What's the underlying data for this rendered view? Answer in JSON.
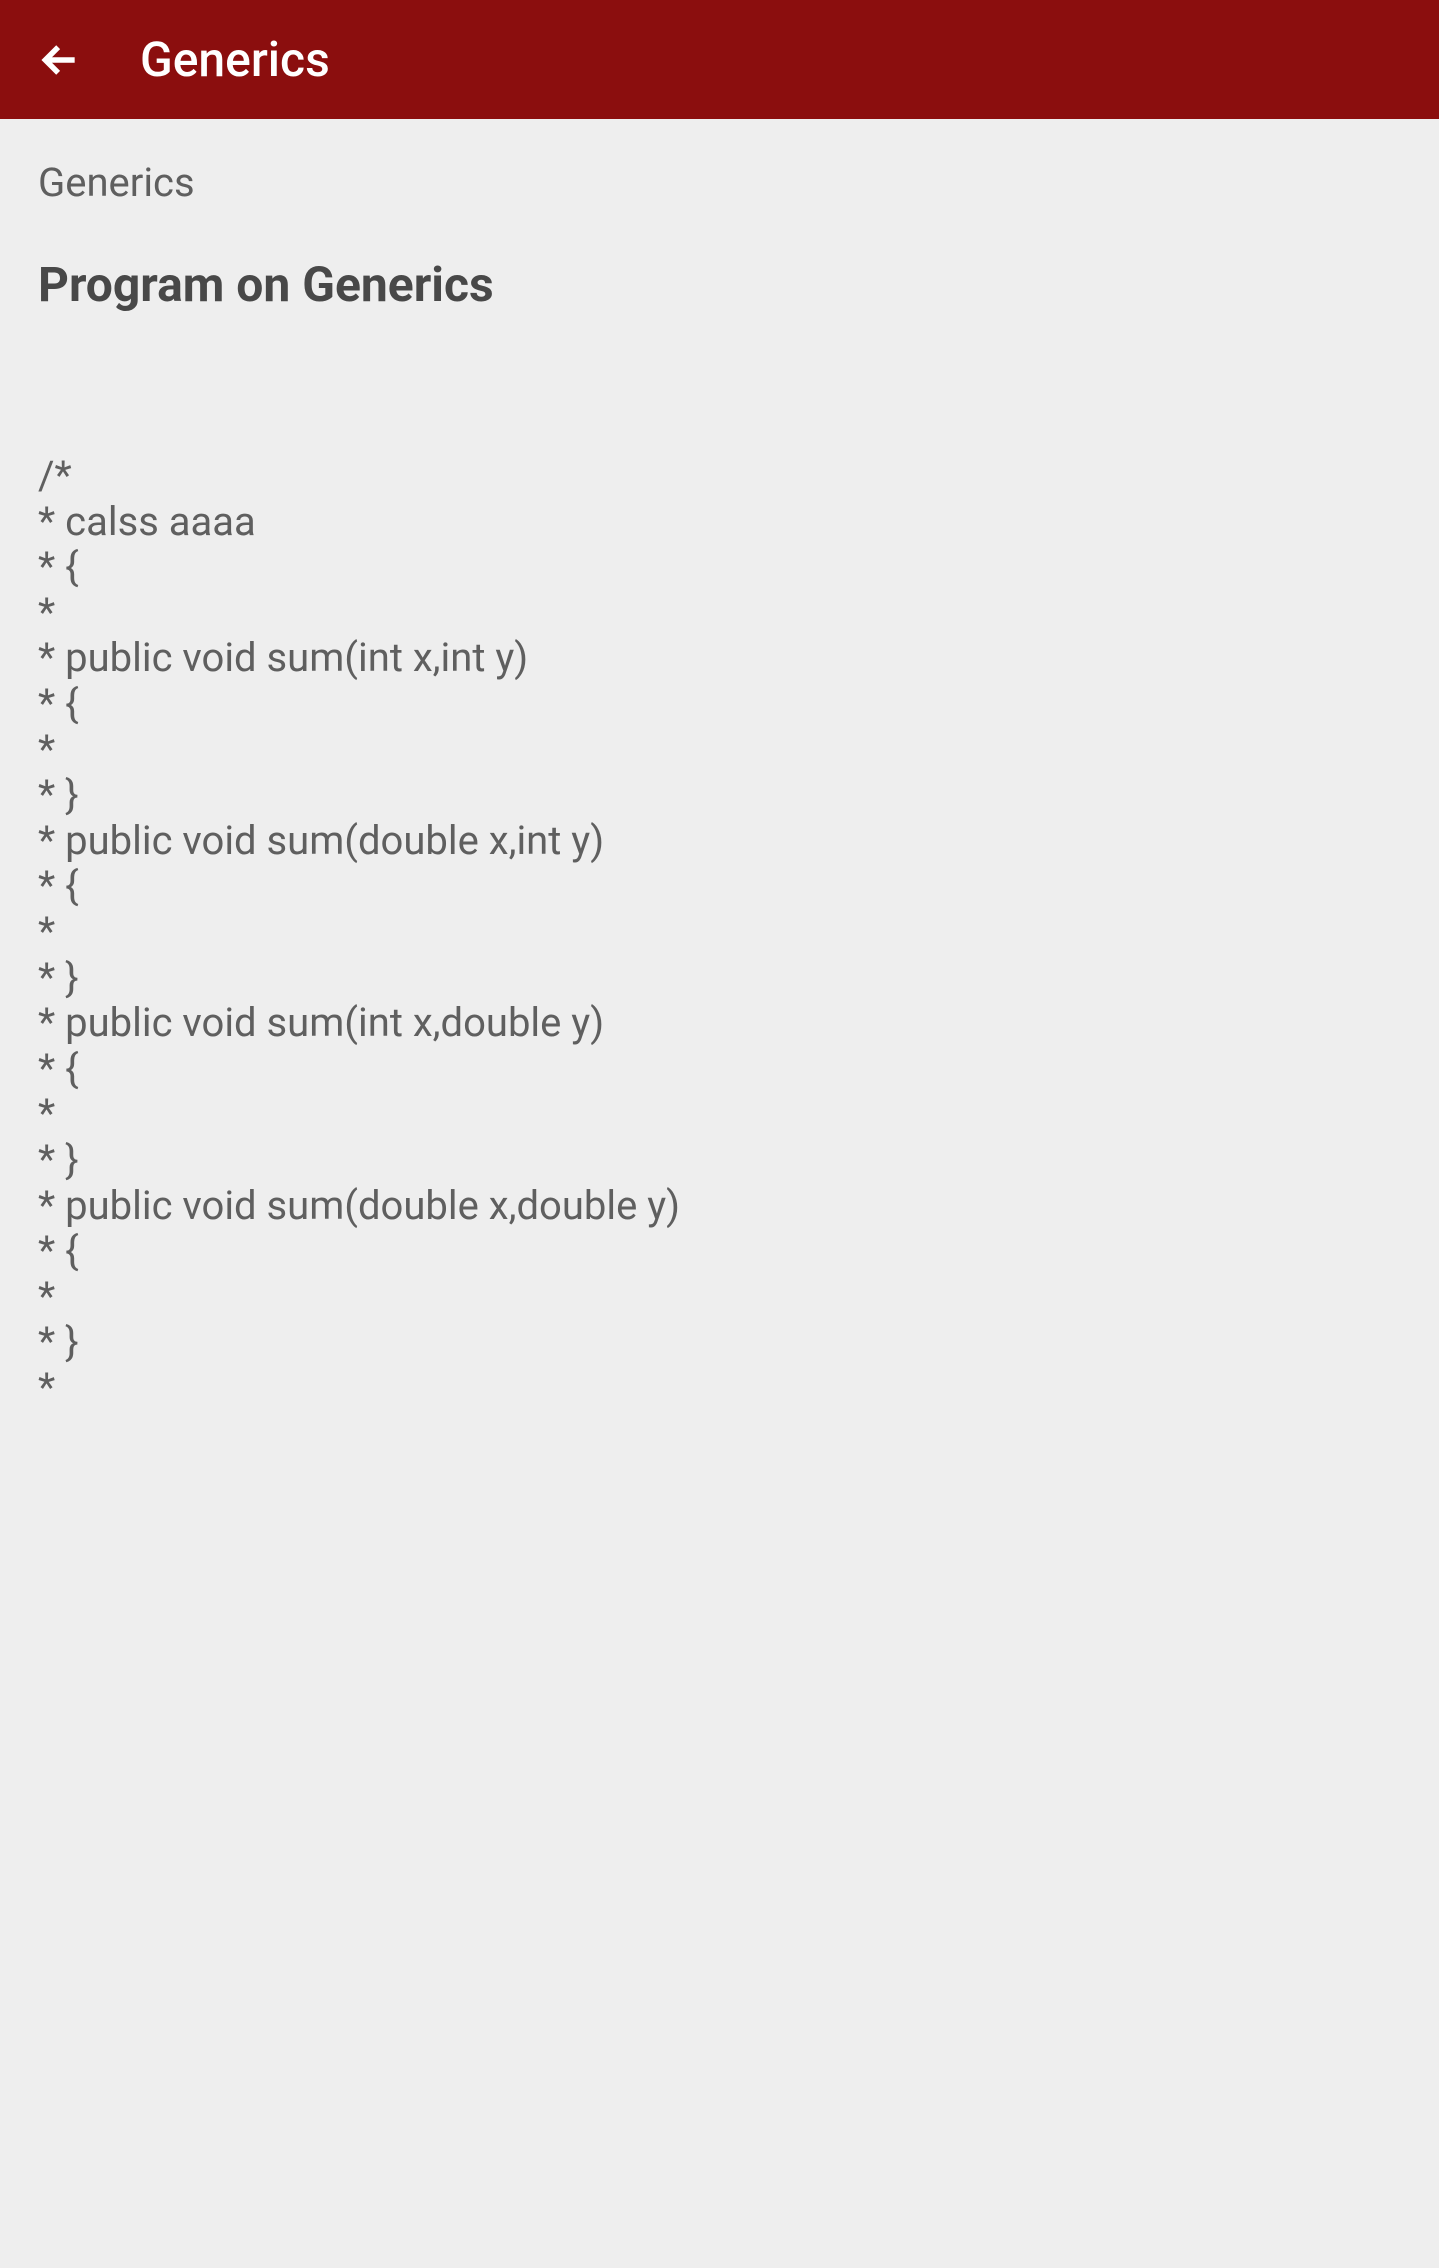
{
  "header": {
    "title": "Generics"
  },
  "content": {
    "subtitle": "Generics",
    "sectionTitle": "Program on Generics",
    "code": "/*\n* calss aaaa\n* {\n*\n* public void sum(int x,int y)\n* {\n*\n* }\n* public void sum(double x,int y)\n* {\n*\n* }\n* public void sum(int x,double y)\n* {\n*\n* }\n* public void sum(double x,double y)\n* {\n*\n* }\n*"
  }
}
